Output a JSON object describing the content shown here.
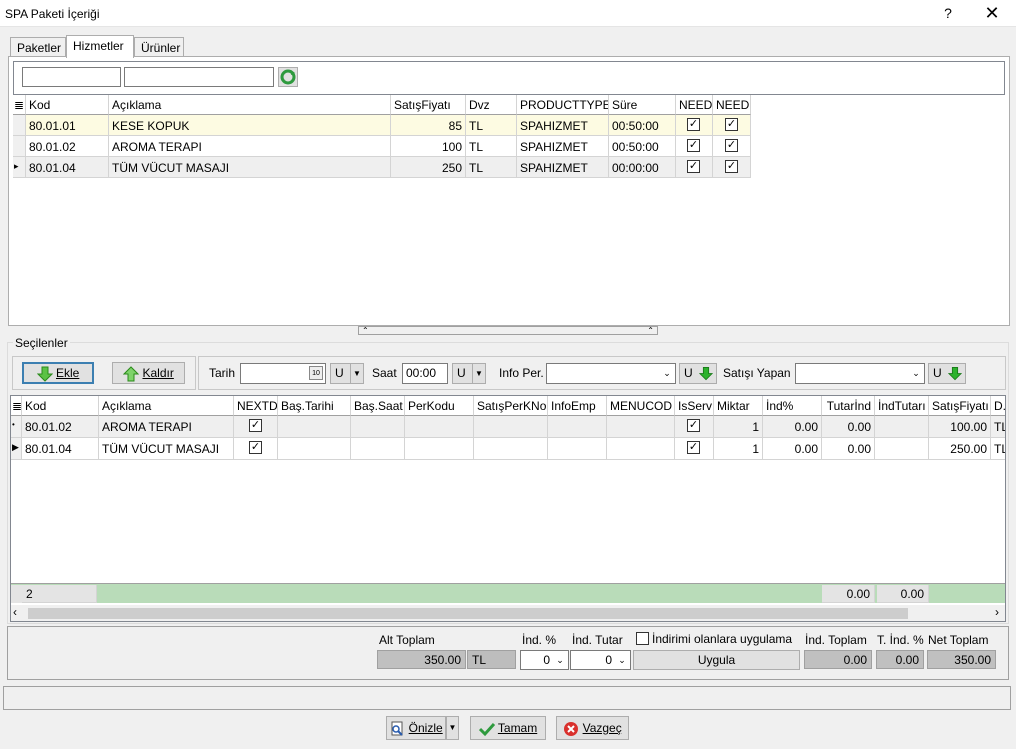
{
  "window": {
    "title": "SPA Paketi İçeriği",
    "help": "?",
    "close": "✕"
  },
  "tabs": [
    "Paketler",
    "Hizmetler",
    "Ürünler"
  ],
  "top_grid": {
    "headers": [
      "Kod",
      "Açıklama",
      "SatışFiyatı",
      "Dvz",
      "PRODUCTTYPE",
      "Süre",
      "NEED",
      "NEED"
    ],
    "rows": [
      [
        "80.01.01",
        "KESE KOPUK",
        "85",
        "TL",
        "SPAHIZMET",
        "00:50:00"
      ],
      [
        "80.01.02",
        "AROMA TERAPI",
        "100",
        "TL",
        "SPAHIZMET",
        "00:50:00"
      ],
      [
        "80.01.04",
        "TÜM VÜCUT MASAJI",
        "250",
        "TL",
        "SPAHIZMET",
        "00:00:00"
      ]
    ]
  },
  "selected": {
    "legend": "Seçilenler",
    "add": "Ekle",
    "remove": "Kaldır",
    "date_label": "Tarih",
    "date_btn": "U",
    "time_label": "Saat",
    "time_value": "00:00",
    "time_btn": "U",
    "info_label": "Info Per.",
    "info_btn": "U",
    "seller_label": "Satışı Yapan",
    "seller_btn": "U"
  },
  "bottom_grid": {
    "headers": [
      "Kod",
      "Açıklama",
      "NEXTD",
      "Baş.Tarihi",
      "Baş.Saat",
      "PerKodu",
      "SatışPerKNo",
      "InfoEmp",
      "MENUCOD",
      "IsServ",
      "Miktar",
      "İnd%",
      "Tutarİnd",
      "İndTutarı",
      "SatışFiyatı",
      "D."
    ],
    "rows": [
      [
        "80.01.02",
        "AROMA TERAPI",
        "1",
        "0.00",
        "0.00",
        "100.00",
        "TL"
      ],
      [
        "80.01.04",
        "TÜM VÜCUT MASAJI",
        "1",
        "0.00",
        "0.00",
        "250.00",
        "TL"
      ]
    ],
    "footer": {
      "count": "2",
      "f1": "0.00",
      "f2": "0.00"
    }
  },
  "totals": {
    "alt_toplam_label": "Alt Toplam",
    "alt_toplam": "350.00",
    "currency": "TL",
    "ind_pct_label": "İnd. %",
    "ind_pct": "0",
    "ind_tutar_label": "İnd. Tutar",
    "ind_tutar": "0",
    "apply_check_label": "İndirimi olanlara uygulama",
    "apply_btn": "Uygula",
    "ind_toplam_label": "İnd. Toplam",
    "ind_toplam": "0.00",
    "t_ind_label": "T. İnd. %",
    "t_ind": "0.00",
    "net_label": "Net Toplam",
    "net": "350.00"
  },
  "footer_buttons": {
    "preview": "Önizle",
    "ok": "Tamam",
    "cancel": "Vazgeç"
  }
}
